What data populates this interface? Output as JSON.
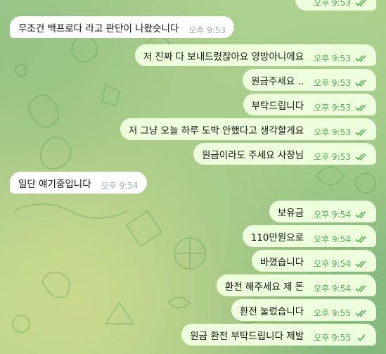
{
  "messages": [
    {
      "dir": "out",
      "text": "",
      "time": "오후 9:53",
      "read": true
    },
    {
      "dir": "in",
      "text": "무조건 백프로다 라고 판단이 나왔슷니다",
      "time": "오후 9:53"
    },
    {
      "dir": "out",
      "text": "저 진짜 다 보내드렸잖아요 양방아니에요",
      "time": "오후 9:53",
      "read": true
    },
    {
      "dir": "out",
      "text": "원금주세요 ..",
      "time": "오후 9:53",
      "read": true
    },
    {
      "dir": "out",
      "text": "부탁드립니다",
      "time": "오후 9:53",
      "read": true
    },
    {
      "dir": "out",
      "text": "저 그냥 오늘 하루 도박 안했다고 생각할게요",
      "time": "오후 9:53",
      "read": true
    },
    {
      "dir": "out",
      "text": "원금이라도 주세요 사장님",
      "time": "오후 9:53",
      "read": true
    },
    {
      "dir": "in",
      "text": "일단 얘기중입니다",
      "time": "오후 9:54"
    },
    {
      "dir": "out",
      "text": "보유금",
      "time": "오후 9:54",
      "read": true
    },
    {
      "dir": "out",
      "text": "110만원으로",
      "time": "오후 9:54",
      "read": true
    },
    {
      "dir": "out",
      "text": "바꼈습니다",
      "time": "오후 9:54",
      "read": true
    },
    {
      "dir": "out",
      "text": "환전 해주세요 제 돈",
      "time": "오후 9:54",
      "read": true
    },
    {
      "dir": "out",
      "text": "환전 눌렀습니다",
      "time": "오후 9:55",
      "read": true
    },
    {
      "dir": "out",
      "text": "원금 환전 부탁드립니다 제발",
      "time": "오후 9:55",
      "read": false
    }
  ],
  "colors": {
    "outgoing_bubble": "#eeffde",
    "incoming_bubble": "#ffffff",
    "outgoing_time": "#4fae4e",
    "incoming_time": "#a0acb6"
  }
}
